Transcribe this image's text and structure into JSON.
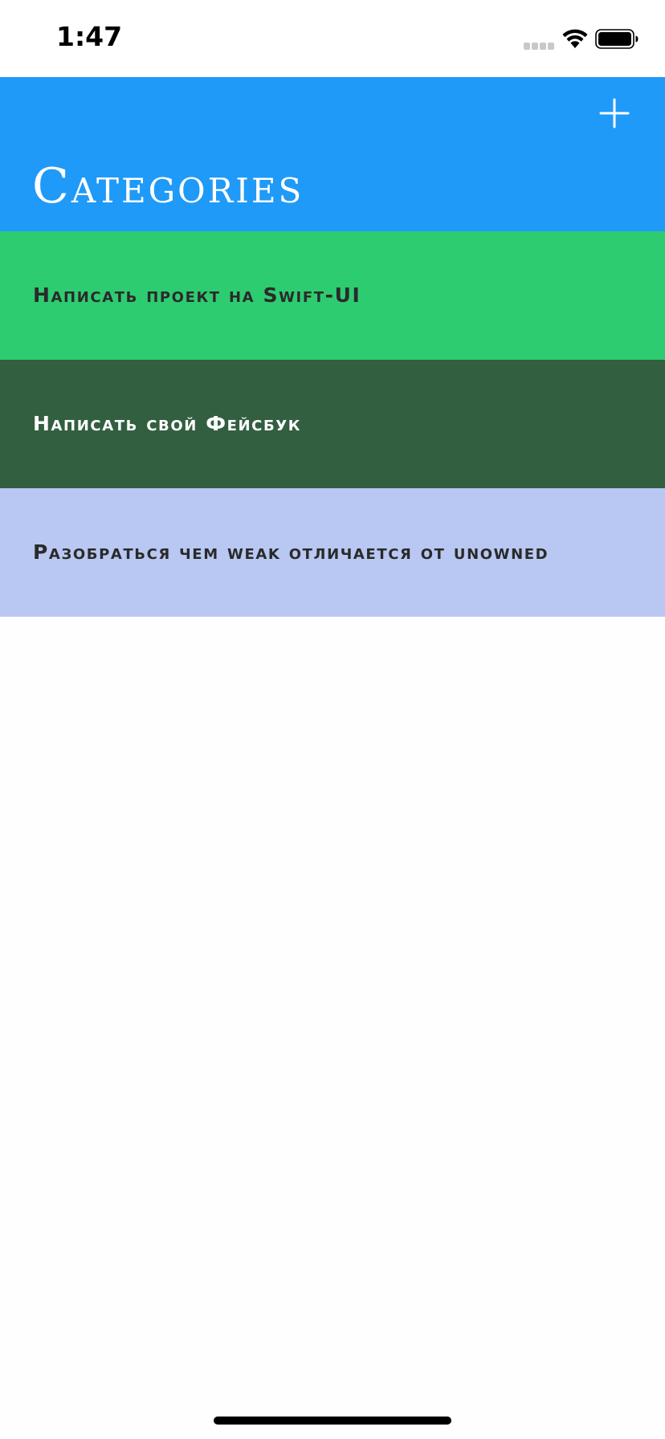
{
  "status_bar": {
    "time": "1:47",
    "signal_icon": "cellular-signal-icon",
    "wifi_icon": "wifi-icon",
    "battery_icon": "battery-icon"
  },
  "nav_bar": {
    "title": "Categories",
    "add_icon": "plus-icon",
    "background": "#1f9af8",
    "title_color": "#ffffff"
  },
  "categories": [
    {
      "title": "Написать проект на Swift-UI",
      "background": "#2ecc71",
      "text_color": "#2a2a2a"
    },
    {
      "title": "Написать свой Фейсбук",
      "background": "#335f41",
      "text_color": "#ffffff"
    },
    {
      "title": "Разобраться чем weak отличается от unowned",
      "background": "#b8c8f2",
      "text_color": "#2a2a2a"
    }
  ]
}
